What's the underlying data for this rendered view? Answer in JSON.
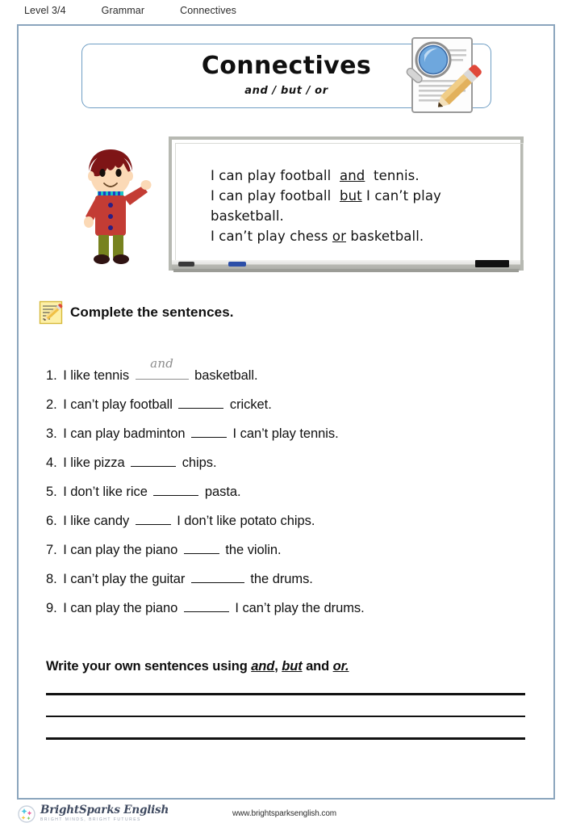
{
  "header": {
    "items": [
      {
        "label": "Level 3/4"
      },
      {
        "label": "Grammar"
      },
      {
        "label": "Connectives"
      }
    ]
  },
  "title_banner": {
    "title": "Connectives",
    "subtitle": "and / but / or",
    "icon": "document-magnifier-pencil-icon"
  },
  "illustration": {
    "name": "boy-waving-illustration",
    "colors": {
      "hair": "#7e1516",
      "skin": "#fbd9b6",
      "coat": "#c33c34",
      "pants": "#77821f",
      "shoes": "#2f1312",
      "collar_stripe": "#1c3fc4"
    }
  },
  "whiteboard": {
    "name": "whiteboard-examples",
    "lines": [
      {
        "parts": [
          {
            "text": "I can play football  ",
            "underline": false
          },
          {
            "text": "and",
            "underline": true
          },
          {
            "text": "  tennis.",
            "underline": false
          }
        ]
      },
      {
        "parts": [
          {
            "text": "I can play football  ",
            "underline": false
          },
          {
            "text": "but",
            "underline": true
          },
          {
            "text": " I can’t play",
            "underline": false
          }
        ]
      },
      {
        "parts": [
          {
            "text": "basketball.",
            "underline": false
          }
        ]
      },
      {
        "parts": [
          {
            "text": "I can’t play chess ",
            "underline": false
          },
          {
            "text": "or",
            "underline": true
          },
          {
            "text": " basketball.",
            "underline": false
          }
        ]
      }
    ],
    "tray": {
      "marker_black": "black-marker",
      "marker_blue": "blue-marker",
      "eraser": "board-eraser"
    }
  },
  "instruction": {
    "icon": "notepad-pencil-icon",
    "text": "Complete the sentences."
  },
  "questions": [
    {
      "number": "1.",
      "before": "I like tennis",
      "blank_width": "filled",
      "answer": "and",
      "after": "basketball."
    },
    {
      "number": "2.",
      "before": "I can’t play football",
      "blank_width": "w5",
      "answer": "",
      "after": "cricket."
    },
    {
      "number": "3.",
      "before": "I can play badminton",
      "blank_width": "w4",
      "answer": "",
      "after": "I can’t play tennis."
    },
    {
      "number": "4.",
      "before": "I like pizza",
      "blank_width": "w5",
      "answer": "",
      "after": "chips."
    },
    {
      "number": "5.",
      "before": "I don’t like rice",
      "blank_width": "w5",
      "answer": "",
      "after": "pasta."
    },
    {
      "number": "6.",
      "before": "I like candy",
      "blank_width": "w4",
      "answer": "",
      "after": "I don’t like potato chips."
    },
    {
      "number": "7.",
      "before": "I can play the piano",
      "blank_width": "w4",
      "answer": "",
      "after": "the violin."
    },
    {
      "number": "8.",
      "before": "I can’t play the guitar",
      "blank_width": "w6",
      "answer": "",
      "after": "the drums."
    },
    {
      "number": "9.",
      "before": "I can play the piano",
      "blank_width": "w5",
      "answer": "",
      "after": "I can’t play the drums."
    }
  ],
  "write_section": {
    "heading_parts": [
      {
        "text": "Write your own sentences using ",
        "emphasis": false
      },
      {
        "text": "and",
        "emphasis": true
      },
      {
        "text": ", ",
        "emphasis": false
      },
      {
        "text": "but",
        "emphasis": true
      },
      {
        "text": " and ",
        "emphasis": false
      },
      {
        "text": "or.",
        "emphasis": true
      }
    ],
    "line_count": 3
  },
  "footer": {
    "brand_name": "BrightSparks English",
    "brand_tagline": "BRIGHT MINDS, BRIGHT FUTURES",
    "brand_icon": "sparkle-badge-icon",
    "url": "www.brightsparksenglish.com"
  },
  "colors": {
    "page_border": "#8ba5bd",
    "banner_border": "#6f9ec4",
    "text": "#111111",
    "answer_gray": "#8d8d8d",
    "brand": "#3f4a60"
  }
}
